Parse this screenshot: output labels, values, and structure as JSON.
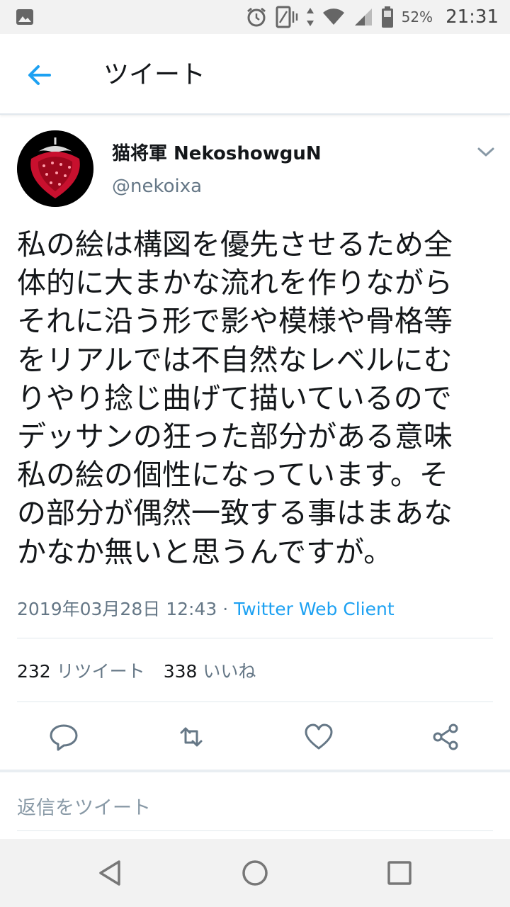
{
  "status_bar": {
    "battery_percent": "52%",
    "time": "21:31"
  },
  "app_bar": {
    "title": "ツイート"
  },
  "author": {
    "display_name": "猫将軍 NekoshowguN",
    "handle": "@nekoixa"
  },
  "tweet": {
    "lines": [
      "私の絵は構図を優先させるため全",
      "体的に大まかな流れを作りながら",
      "それに沿う形で影や模様や骨格等",
      "をリアルでは不自然なレベルにむ",
      "りやり捻じ曲げて描いているので",
      "デッサンの狂った部分がある意味",
      "私の絵の個性になっています。そ",
      "の部分が偶然一致する事はまあな",
      "かなか無いと思うんですが。"
    ],
    "timestamp": "2019年03月28日 12:43",
    "separator": " · ",
    "client": "Twitter Web Client"
  },
  "stats": {
    "retweet_count": "232",
    "retweet_label": "リツイート",
    "like_count": "338",
    "like_label": "いいね"
  },
  "reply_box": {
    "placeholder": "返信をツイート"
  },
  "colors": {
    "accent": "#1da1f2",
    "secondary_text": "#657786",
    "icon_gray": "#657786"
  }
}
